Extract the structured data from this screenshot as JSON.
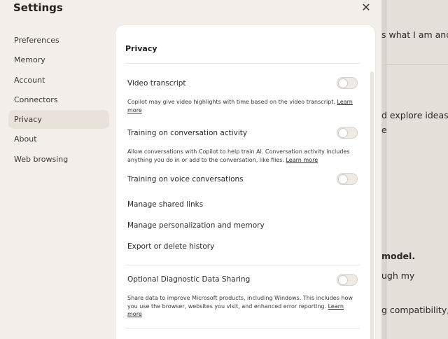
{
  "dialog": {
    "title": "Settings",
    "close_symbol": "✕"
  },
  "nav": {
    "items": [
      {
        "label": "Preferences"
      },
      {
        "label": "Memory"
      },
      {
        "label": "Account"
      },
      {
        "label": "Connectors"
      },
      {
        "label": "Privacy",
        "active": true
      },
      {
        "label": "About"
      },
      {
        "label": "Web browsing"
      }
    ]
  },
  "privacy": {
    "title": "Privacy",
    "video_transcript": {
      "label": "Video transcript",
      "desc": "Copilot may give video highlights with time based on the video transcript.",
      "link": "Learn more",
      "enabled": false
    },
    "training_conversation": {
      "label": "Training on conversation activity",
      "desc": "Allow conversations with Copilot to help train AI. Conversation activity includes anything you do in or add to the conversation, like files.",
      "link": "Learn more",
      "enabled": false
    },
    "training_voice": {
      "label": "Training on voice conversations",
      "enabled": false
    },
    "manage_shared_links": "Manage shared links",
    "manage_personalization": "Manage personalization and memory",
    "export_delete": "Export or delete history",
    "diagnostic": {
      "label": "Optional Diagnostic Data Sharing",
      "desc": "Share data to improve Microsoft products, including Windows. This includes how you use the browser, websites you visit, and enhanced error reporting.",
      "link": "Learn more",
      "enabled": false
    }
  },
  "background": {
    "line1": "s what I am and",
    "line2": "d explore ideas.",
    "line3": "e",
    "line4": "model.",
    "line5": "ugh my",
    "line6": "g compatibility,"
  }
}
